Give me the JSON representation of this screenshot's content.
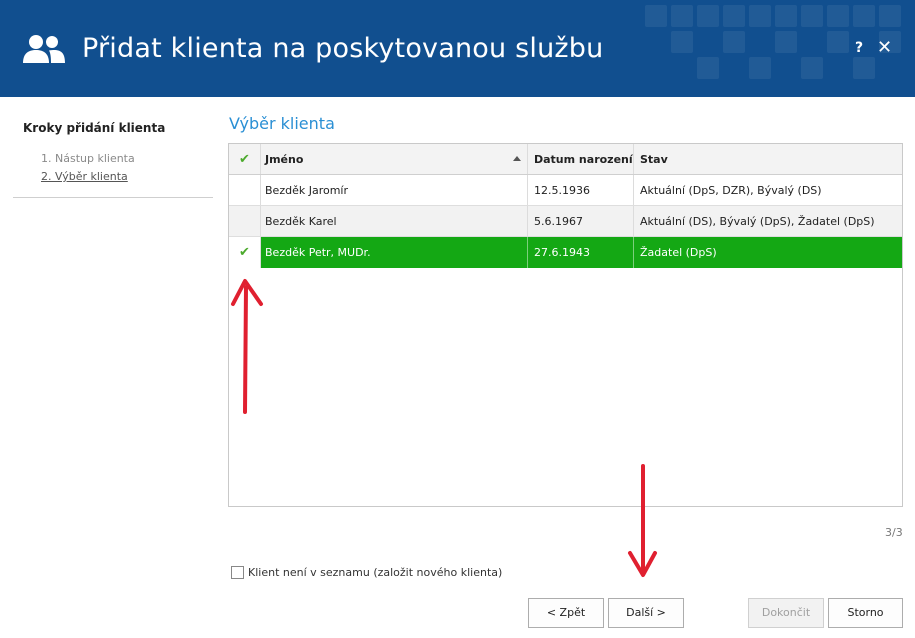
{
  "header": {
    "title": "Přidat klienta na poskytovanou službu",
    "help": "?",
    "close": "✕",
    "icon": "users-icon",
    "background": "#114f8f"
  },
  "sidebar": {
    "title": "Kroky přidání klienta",
    "steps": [
      {
        "label": "1. Nástup klienta"
      },
      {
        "label": "2. Výběr klienta"
      }
    ]
  },
  "main": {
    "section_title": "Výběr klienta",
    "table": {
      "columns": [
        "✔",
        "Jméno",
        "Datum narození",
        "Stav"
      ],
      "rows": [
        {
          "selected": "",
          "name": "Bezděk Jaromír",
          "dob": "12.5.1936",
          "status": "Aktuální (DpS, DZR), Bývalý (DS)"
        },
        {
          "selected": "",
          "name": "Bezděk Karel",
          "dob": "5.6.1967",
          "status": "Aktuální (DS), Bývalý (DpS), Žadatel (DpS)"
        },
        {
          "selected": "✔",
          "name": "Bezděk Petr, MUDr.",
          "dob": "27.6.1943",
          "status": "Žadatel (DpS)"
        }
      ],
      "selected_row_color": "#14a814"
    },
    "pager": "3/3",
    "new_client_label": "Klient není v seznamu (založit nového klienta)"
  },
  "buttons": {
    "back": "< Zpět",
    "next": "Další >",
    "finish": "Dokončit",
    "cancel": "Storno"
  },
  "annotation_color": "#e02030"
}
